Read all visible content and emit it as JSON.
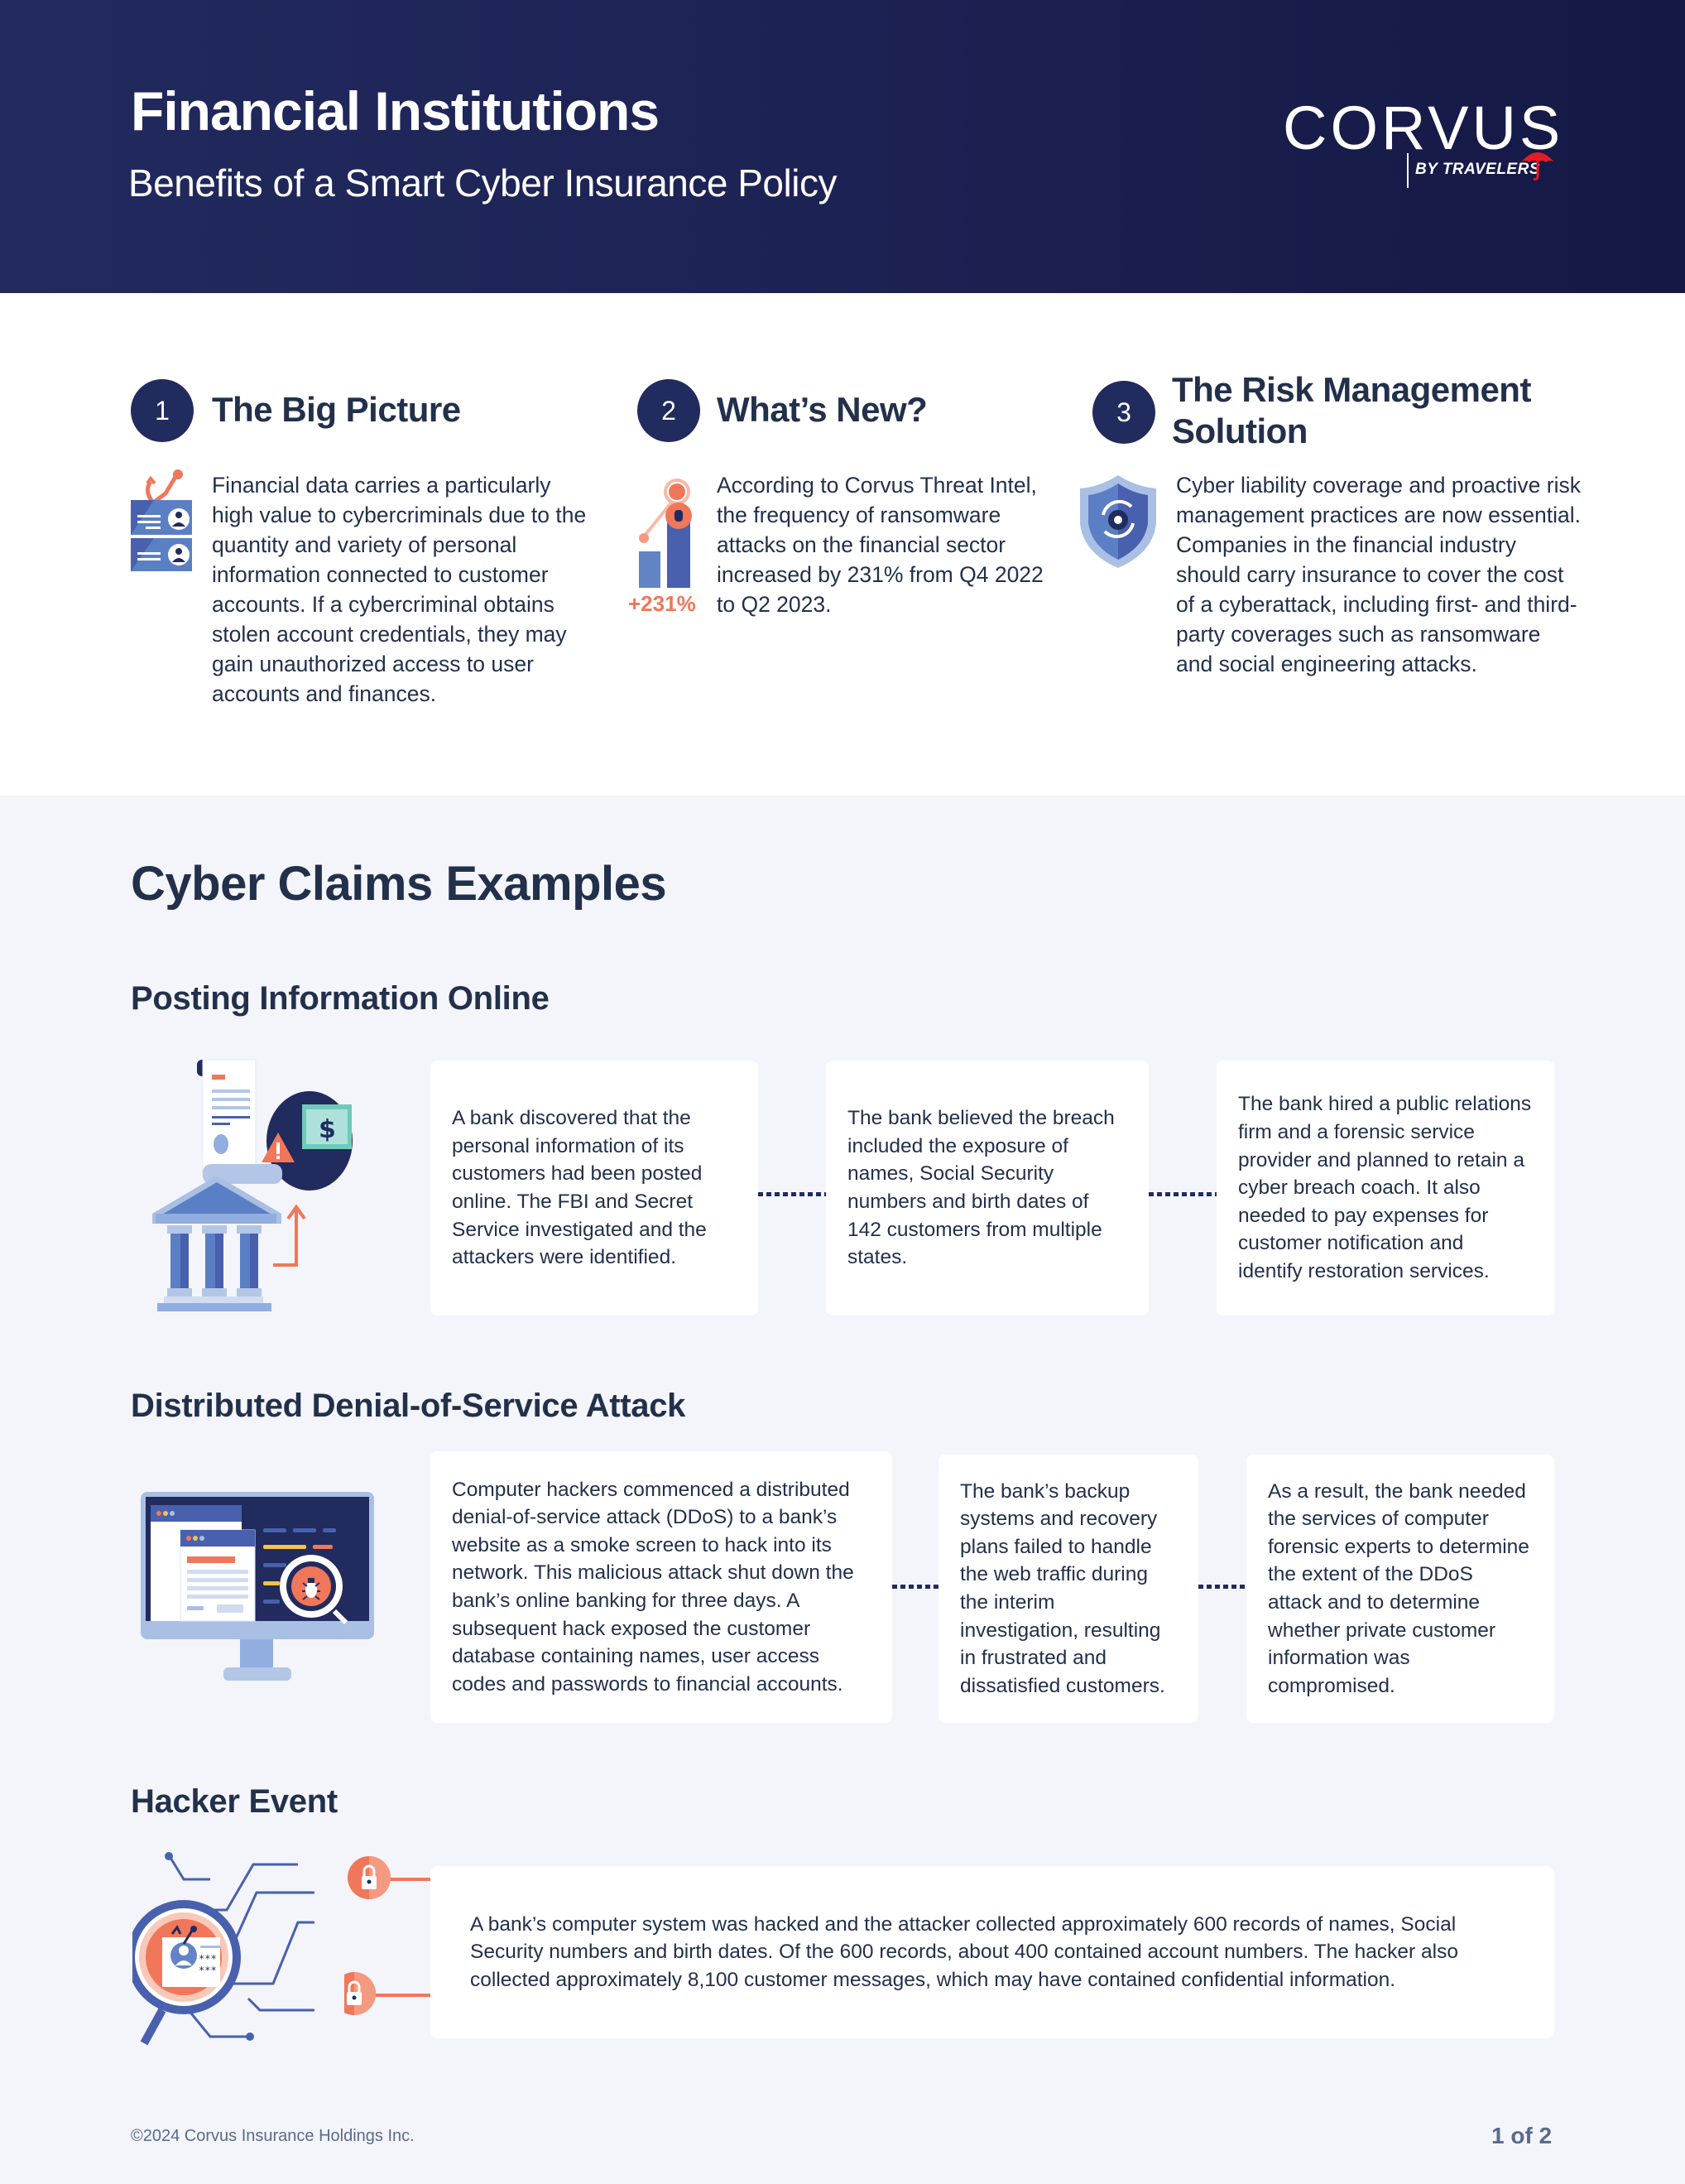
{
  "header": {
    "title": "Financial Institutions",
    "subtitle": "Benefits of a Smart Cyber Insurance Policy",
    "logo": {
      "name": "CORVUS",
      "tagline": "BY TRAVELERS",
      "umbrella_color": "#e31b23"
    }
  },
  "overview": [
    {
      "number": "1",
      "title": "The Big Picture",
      "icon": "phishing-id-cards-icon",
      "body": "Financial data carries a particularly high value to cybercriminals due to the quantity and variety of personal information connected to customer accounts. If a cybercriminal obtains stolen account credentials, they may gain unauthorized access to user accounts and finances."
    },
    {
      "number": "2",
      "title": "What’s New?",
      "icon": "ransomware-growth-chart-icon",
      "icon_label": "+231%",
      "body": "According to Corvus Threat Intel, the frequency of ransomware attacks on the financial sector increased by 231% from Q4 2022 to Q2 2023."
    },
    {
      "number": "3",
      "title": "The Risk Management Solution",
      "icon": "shield-gear-icon",
      "body": "Cyber liability coverage and proactive risk management practices are now essential. Companies in the financial industry should carry insurance to cover the cost of a cyberattack, including first- and third-party coverages such as ransomware and social engineering attacks."
    }
  ],
  "claims": {
    "title": "Cyber Claims Examples",
    "examples": [
      {
        "title": "Posting Information Online",
        "illustration": "bank-document-leak-icon",
        "steps": [
          "A bank discovered that the personal information of its customers had been posted online. The FBI and Secret Service investigated and the attackers were identified.",
          "The bank believed the breach included the exposure of names, Social Security numbers and birth dates of 142 customers from multiple states.",
          "The bank hired a public relations firm and a forensic service provider and planned to retain a cyber breach coach. It also needed to pay expenses for customer notification and identify restoration services."
        ]
      },
      {
        "title": "Distributed Denial-of-Service Attack",
        "illustration": "monitor-bug-magnifier-icon",
        "steps": [
          "Computer hackers commenced a distributed denial-of-service attack (DDoS) to a bank’s website as a smoke screen to hack into its network. This malicious attack shut down the bank’s online banking for three days. A subsequent hack exposed the customer database containing names, user access codes and passwords to financial accounts.",
          "The bank’s backup systems and recovery plans failed to handle the web traffic during the interim investigation, resulting in frustrated and dissatisfied customers.",
          "As a result, the bank needed the services of computer forensic experts to determine the extent of the DDoS attack and to determine whether private customer information was compromised."
        ]
      },
      {
        "title": "Hacker Event",
        "illustration": "magnifier-credentials-locks-icon",
        "steps": [
          "A bank’s computer system was hacked and the attacker collected approximately 600 records of names, Social Security numbers and birth dates. Of the 600 records, about 400 contained account numbers. The hacker also collected approximately 8,100 customer messages, which may have contained confidential information."
        ]
      }
    ]
  },
  "footer": {
    "copyright": "©2024 Corvus Insurance Holdings Inc.",
    "page": "1 of 2"
  },
  "colors": {
    "navy": "#212b5e",
    "text": "#22304b",
    "accent_orange": "#f0775a",
    "blue": "#4a62ad",
    "light_blue": "#a9bfe3",
    "gray_bg": "#f4f5fa"
  }
}
